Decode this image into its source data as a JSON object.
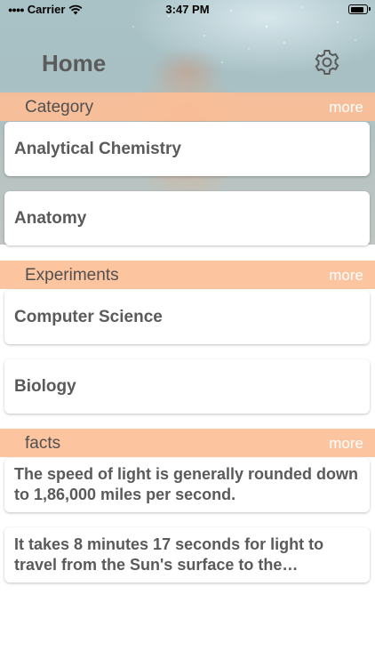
{
  "status_bar": {
    "carrier": "Carrier",
    "time": "3:47 PM"
  },
  "header": {
    "title": "Home"
  },
  "sections": {
    "category": {
      "label": "Category",
      "more": "more",
      "items": [
        "Analytical Chemistry",
        "Anatomy"
      ]
    },
    "experiments": {
      "label": "Experiments",
      "more": "more",
      "items": [
        "Computer Science",
        "Biology"
      ]
    },
    "facts": {
      "label": "facts",
      "more": "more",
      "items": [
        "The speed of light is generally rounded down to 1,86,000 miles per second.",
        "It takes 8 minutes 17 seconds for light to travel from the Sun's surface to the…"
      ]
    }
  },
  "icons": {
    "settings": "gear-icon",
    "wifi": "wifi-icon",
    "battery": "battery-icon"
  },
  "colors": {
    "section_header": "#fdc4a0",
    "title_text": "#5b5b5b",
    "card_text": "#5a5a5a"
  }
}
